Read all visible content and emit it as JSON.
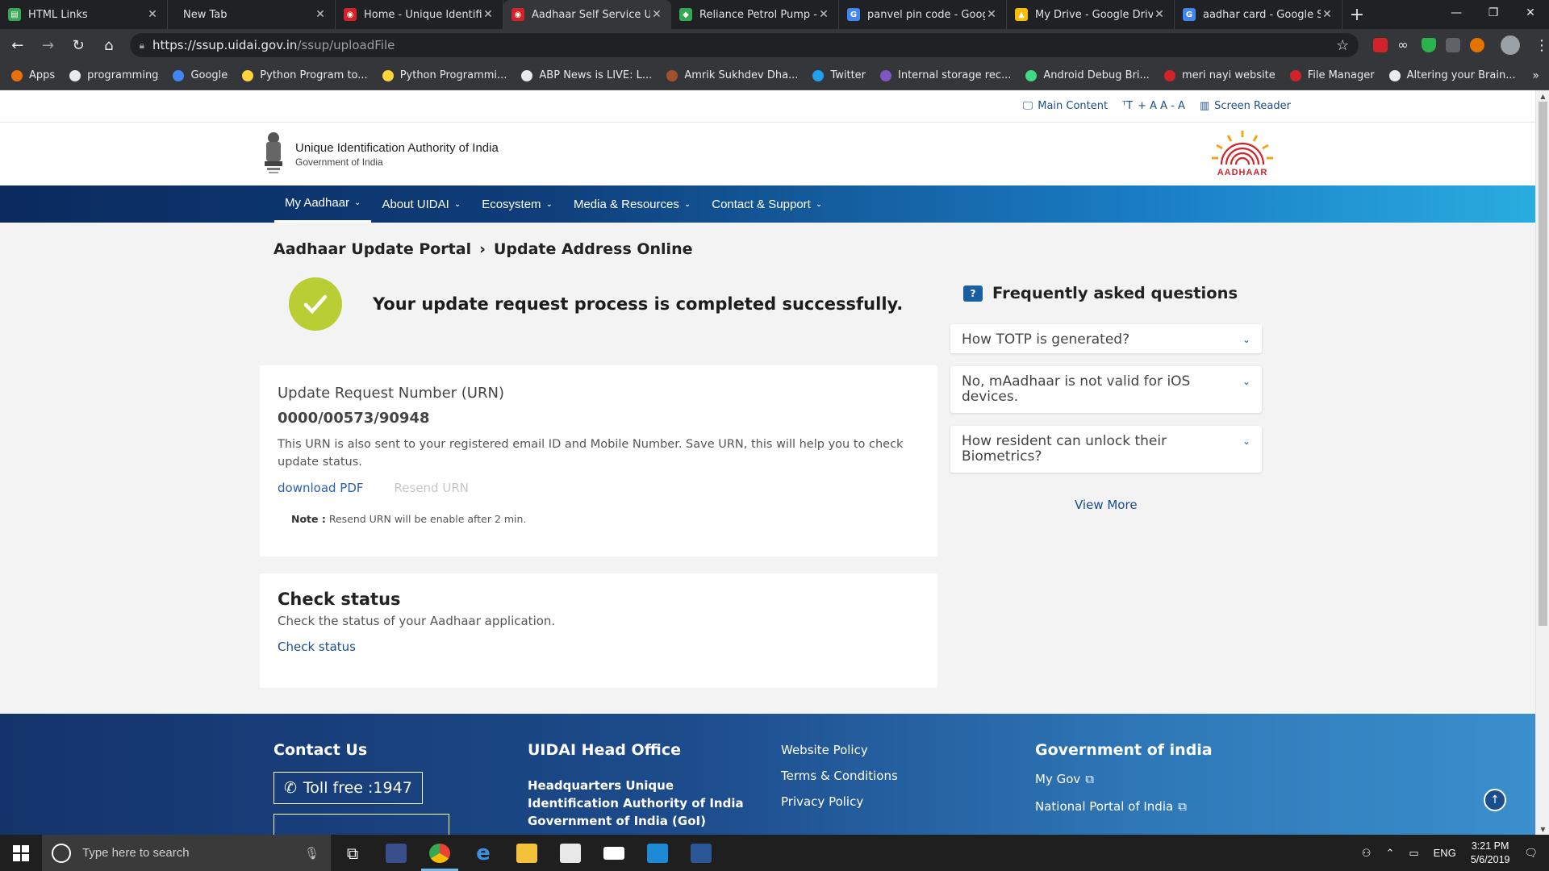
{
  "browser": {
    "tabs": [
      {
        "title": "HTML Links",
        "color": "#3aa757",
        "glyph": "▤"
      },
      {
        "title": "New Tab",
        "color": "",
        "glyph": ""
      },
      {
        "title": "Home - Unique Identifi",
        "color": "#d2232a",
        "glyph": "◉"
      },
      {
        "title": "Aadhaar Self Service Up",
        "color": "#d2232a",
        "glyph": "◉"
      },
      {
        "title": "Reliance Petrol Pump -",
        "color": "#34a853",
        "glyph": "◆"
      },
      {
        "title": "panvel pin code - Goog",
        "color": "#4285f4",
        "glyph": "G"
      },
      {
        "title": "My Drive - Google Driv",
        "color": "#fbbc04",
        "glyph": "▲"
      },
      {
        "title": "aadhar card - Google S",
        "color": "#4285f4",
        "glyph": "G"
      }
    ],
    "active_tab": 3,
    "url_host": "https://ssup.uidai.gov.in",
    "url_path": "/ssup/uploadFile",
    "bookmarks": [
      {
        "label": "Apps",
        "color": "#e8710a"
      },
      {
        "label": "programming",
        "color": "#e8eaed"
      },
      {
        "label": "Google",
        "color": "#4285f4"
      },
      {
        "label": "Python Program to...",
        "color": "#ffd43b"
      },
      {
        "label": "Python Programmi...",
        "color": "#ffd43b"
      },
      {
        "label": "ABP News is LIVE: L...",
        "color": "#e8eaed"
      },
      {
        "label": "Amrik Sukhdev Dha...",
        "color": "#a0522d"
      },
      {
        "label": "Twitter",
        "color": "#1da1f2"
      },
      {
        "label": "Internal storage rec...",
        "color": "#7e57c2"
      },
      {
        "label": "Android Debug Bri...",
        "color": "#3ddc84"
      },
      {
        "label": "meri nayi website",
        "color": "#d2232a"
      },
      {
        "label": "File Manager",
        "color": "#d2232a"
      },
      {
        "label": "Altering your Brain...",
        "color": "#e8eaed"
      }
    ]
  },
  "page": {
    "utility": {
      "main_content": "Main Content",
      "text_size": "+ A A - A",
      "screen_reader": "Screen Reader"
    },
    "org_name": "Unique Identification Authority of India",
    "org_sub": "Government of India",
    "logo_word": "AADHAAR",
    "nav": [
      "My Aadhaar",
      "About UIDAI",
      "Ecosystem",
      "Media & Resources",
      "Contact & Support"
    ],
    "breadcrumb": {
      "parent": "Aadhaar Update Portal",
      "sep": "›",
      "current": "Update Address Online"
    },
    "success_msg": "Your update request process is completed successfully.",
    "urn": {
      "label": "Update Request Number (URN)",
      "value": "0000/00573/90948",
      "desc": "This URN is also sent to your registered email ID and Mobile Number. Save URN, this will help you to check update status.",
      "download": "download PDF",
      "resend": "Resend URN",
      "note_label": "Note :",
      "note_text": " Resend URN will be enable after 2 min."
    },
    "check": {
      "heading": "Check status",
      "text": "Check the status of your Aadhaar application.",
      "link": "Check status"
    },
    "faq": {
      "heading": "Frequently asked questions",
      "items": [
        "How TOTP is generated?",
        "No, mAadhaar is not valid for iOS devices.",
        "How resident can unlock their Biometrics?"
      ],
      "view_more": "View More"
    },
    "footer": {
      "contact": "Contact Us",
      "toll": "Toll free :1947",
      "head_office": "UIDAI Head Office",
      "hq_text": "Headquarters Unique Identification Authority of India Government of India (GoI)",
      "links": [
        "Website Policy",
        "Terms & Conditions",
        "Privacy Policy"
      ],
      "gov_heading": "Government of india",
      "gov_links": [
        "My Gov",
        "National Portal of India"
      ]
    }
  },
  "taskbar": {
    "search_placeholder": "Type here to search",
    "lang": "ENG",
    "time": "3:21 PM",
    "date": "5/6/2019"
  }
}
